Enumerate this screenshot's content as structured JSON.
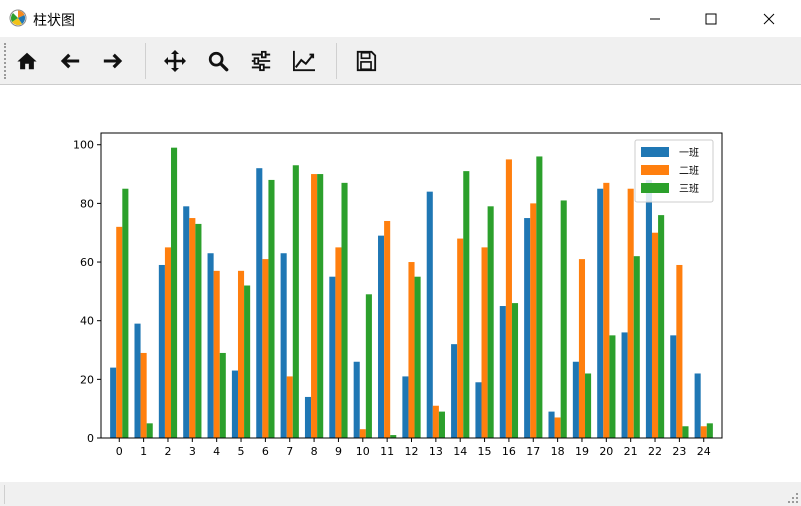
{
  "window": {
    "title": "柱状图",
    "icon": "matplotlib-icon",
    "controls": [
      "minimize-icon",
      "maximize-icon",
      "close-icon"
    ]
  },
  "toolbar": {
    "tools": [
      {
        "name": "home",
        "icon": "home-icon"
      },
      {
        "name": "back",
        "icon": "arrow-left-icon"
      },
      {
        "name": "forward",
        "icon": "arrow-right-icon"
      },
      {
        "name": "pan",
        "icon": "move-icon"
      },
      {
        "name": "zoom",
        "icon": "zoom-icon"
      },
      {
        "name": "subplots",
        "icon": "sliders-icon"
      },
      {
        "name": "customize",
        "icon": "chart-edit-icon"
      },
      {
        "name": "save",
        "icon": "save-icon"
      }
    ]
  },
  "chart_data": {
    "type": "bar",
    "categories": [
      "0",
      "1",
      "2",
      "3",
      "4",
      "5",
      "6",
      "7",
      "8",
      "9",
      "10",
      "11",
      "12",
      "13",
      "14",
      "15",
      "16",
      "17",
      "18",
      "19",
      "20",
      "21",
      "22",
      "23",
      "24"
    ],
    "series": [
      {
        "name": "一班",
        "color": "#1f77b4",
        "values": [
          24,
          39,
          59,
          79,
          63,
          23,
          92,
          63,
          14,
          55,
          26,
          69,
          21,
          84,
          32,
          19,
          45,
          75,
          9,
          26,
          85,
          36,
          88,
          35,
          22
        ]
      },
      {
        "name": "二班",
        "color": "#ff7f0e",
        "values": [
          72,
          29,
          65,
          75,
          57,
          57,
          61,
          21,
          90,
          65,
          3,
          74,
          60,
          11,
          68,
          65,
          95,
          80,
          7,
          61,
          87,
          85,
          70,
          59,
          4
        ]
      },
      {
        "name": "三班",
        "color": "#2ca02c",
        "values": [
          85,
          5,
          99,
          73,
          29,
          52,
          88,
          93,
          90,
          87,
          49,
          1,
          55,
          9,
          91,
          79,
          46,
          96,
          81,
          22,
          35,
          62,
          76,
          4,
          5
        ]
      }
    ],
    "ylim": [
      0,
      104
    ],
    "yticks": [
      0,
      20,
      40,
      60,
      80,
      100
    ],
    "legend": "top-right",
    "grid": false
  }
}
